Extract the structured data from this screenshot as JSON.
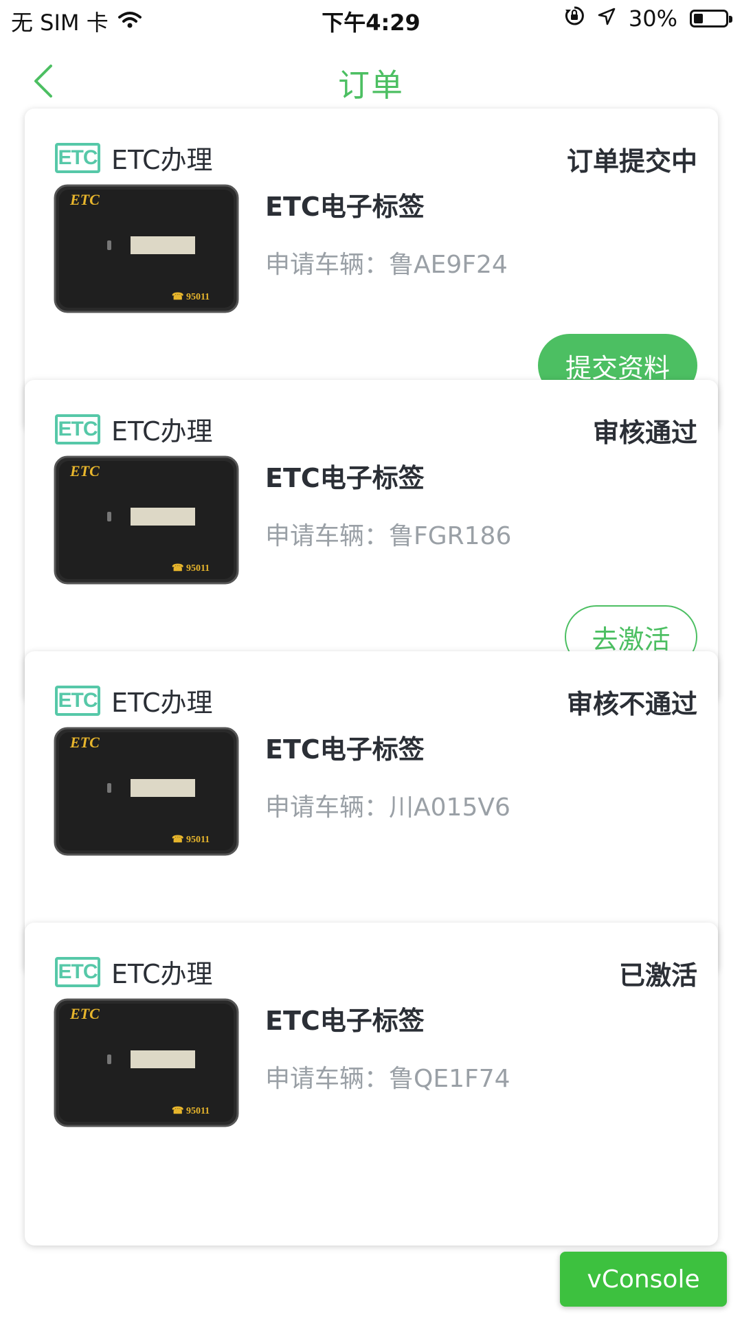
{
  "status_bar": {
    "carrier": "无 SIM 卡",
    "time": "下午4:29",
    "battery_percent": "30%",
    "battery_level": 0.3
  },
  "nav": {
    "title": "订单",
    "back_icon": "chevron-left-icon"
  },
  "colors": {
    "accent": "#4cbf62",
    "etc_logo": "#56c8a8",
    "muted_text": "#9aa0a6"
  },
  "orders": [
    {
      "logo_text": "ETC",
      "service": "ETC办理",
      "status": "订单提交中",
      "product": "ETC电子标签",
      "vehicle_label": "申请车辆：",
      "plate": "鲁AE9F24",
      "action": "提交资料",
      "action_style": "filled",
      "card_brand": "ETC",
      "card_phone": "☎ 95011"
    },
    {
      "logo_text": "ETC",
      "service": "ETC办理",
      "status": "审核通过",
      "product": "ETC电子标签",
      "vehicle_label": "申请车辆：",
      "plate": "鲁FGR186",
      "action": "去激活",
      "action_style": "outline",
      "card_brand": "ETC",
      "card_phone": "☎ 95011"
    },
    {
      "logo_text": "ETC",
      "service": "ETC办理",
      "status": "审核不通过",
      "product": "ETC电子标签",
      "vehicle_label": "申请车辆：",
      "plate": "川A015V6",
      "action": "",
      "action_style": "none",
      "card_brand": "ETC",
      "card_phone": "☎ 95011"
    },
    {
      "logo_text": "ETC",
      "service": "ETC办理",
      "status": "已激活",
      "product": "ETC电子标签",
      "vehicle_label": "申请车辆：",
      "plate": "鲁QE1F74",
      "action": "",
      "action_style": "none",
      "card_brand": "ETC",
      "card_phone": "☎ 95011"
    }
  ],
  "vconsole": {
    "label": "vConsole"
  }
}
